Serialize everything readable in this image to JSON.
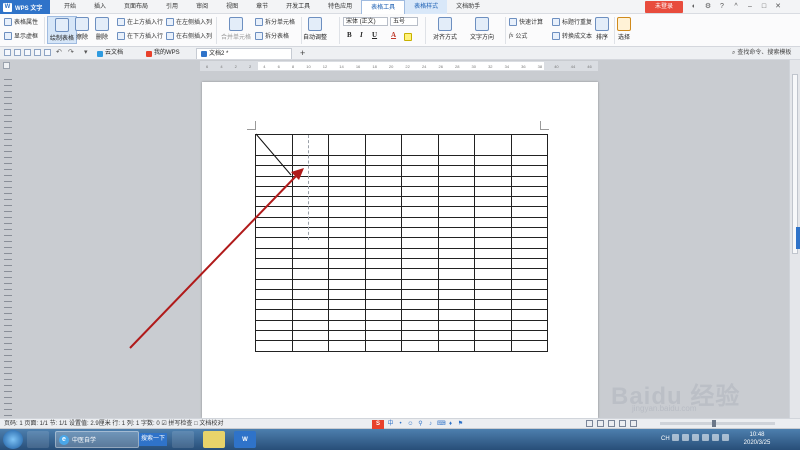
{
  "app": {
    "name": "WPS 文字",
    "login_label": "未登录"
  },
  "menu_tabs": [
    {
      "label": "开始"
    },
    {
      "label": "插入"
    },
    {
      "label": "页面布局"
    },
    {
      "label": "引用"
    },
    {
      "label": "审阅"
    },
    {
      "label": "视图"
    },
    {
      "label": "章节"
    },
    {
      "label": "开发工具"
    },
    {
      "label": "特色应用"
    },
    {
      "label": "表格工具"
    },
    {
      "label": "表格样式"
    },
    {
      "label": "文档助手"
    }
  ],
  "ribbon": {
    "table_props": "表格属性",
    "show_gridlines": "显示虚框",
    "draw_table": "绘制表格",
    "erase": "擦除",
    "delete": "删除",
    "insert_above": "在上方插入行",
    "insert_below": "在下方插入行",
    "insert_left": "在左侧插入列",
    "insert_right": "在右侧插入列",
    "merge_cells": "合并单元格",
    "split_cells": "拆分单元格",
    "split_table": "拆分表格",
    "auto_fit": "自动调整",
    "font_name": "宋体 (正文)",
    "font_size": "五号",
    "bold": "B",
    "italic": "I",
    "underline": "U",
    "font_color": "A",
    "align": "对齐方式",
    "text_dir": "文字方向",
    "quick_calc": "快速计算",
    "formula": "公式",
    "repeat_header": "标题行重复",
    "to_text": "转换成文本",
    "sort": "排序",
    "select": "选择"
  },
  "doc_tabs": [
    {
      "label": "云文档",
      "color": "#2f9be0"
    },
    {
      "label": "我的WPS",
      "color": "#e8412c"
    },
    {
      "label": "文档2 *",
      "color": "#2f73c9",
      "active": true
    }
  ],
  "search_cmd": "查找命令、搜索模板",
  "ruler_ticks": [
    "6",
    "4",
    "2",
    "2",
    "4",
    "6",
    "8",
    "10",
    "12",
    "14",
    "16",
    "18",
    "20",
    "22",
    "24",
    "26",
    "28",
    "30",
    "32",
    "34",
    "36",
    "38",
    "40",
    "44",
    "46"
  ],
  "status": {
    "text": "页码: 1  页面: 1/1  节: 1/1  设置值: 2.9厘米  行: 1  列: 1  字数: 0  ☑ 拼写检查  □ 文档校对"
  },
  "status_tools": [
    "中",
    "•",
    "☺",
    "⚲",
    "♪",
    "⌨",
    "♦",
    "⚑"
  ],
  "taskbar": {
    "task_label": "中医自学",
    "search_label": "搜索一下",
    "lang": "CH",
    "time": "10:48",
    "date": "2020/3/25"
  },
  "watermark": {
    "text": "Baidu 经验",
    "sub": "jingyan.baidu.com"
  },
  "colors": {
    "accent": "#2f73c9",
    "annotation_arrow": "#b01a1a",
    "login": "#e84c3d"
  }
}
